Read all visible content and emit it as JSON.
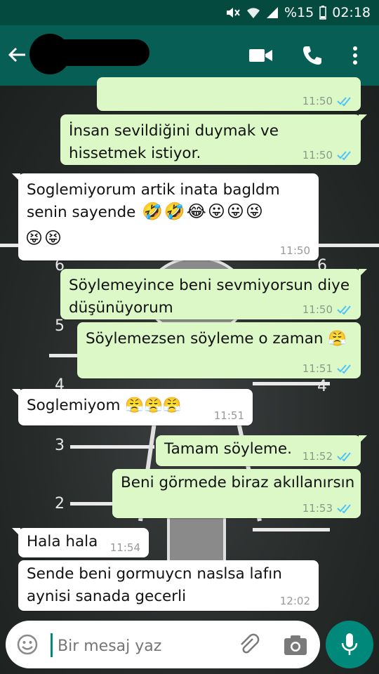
{
  "status_bar": {
    "battery": "%15",
    "time": "02:18"
  },
  "header": {
    "contact_name": ""
  },
  "wallpaper": {
    "ruler_numbers": [
      "6",
      "6",
      "5",
      "4",
      "4",
      "3",
      "2"
    ]
  },
  "messages": [
    {
      "text": "",
      "time": "11:50"
    },
    {
      "text": "İnsan sevildiğini duymak ve\nhissetmek istiyor.",
      "time": "11:50"
    },
    {
      "text": "Soglemiyorum artik inata bagldm\nsenin sayende",
      "emoji": [
        "🤣",
        "🤣",
        "😂",
        "😛",
        "😛",
        "😜",
        "😝",
        "😝"
      ],
      "time": "11:50"
    },
    {
      "text": "Söylemeyince beni sevmiyorsun diye\ndüşünüyorum",
      "time": "11:50"
    },
    {
      "text": "Söylemezsen söyleme o zaman 😤",
      "time": "11:51"
    },
    {
      "text": "Soglemiyom 😤😤😤",
      "time": "11:51"
    },
    {
      "text": "Tamam söyleme.",
      "time": "11:52"
    },
    {
      "text": "Beni görmede biraz akıllanırsın",
      "time": "11:53"
    },
    {
      "text": "Hala hala",
      "time": "11:54"
    },
    {
      "text": "Sende beni gormuycn naslsa lafın\naynisi sanada gecerli",
      "time": "12:02"
    }
  ],
  "composer": {
    "placeholder": "Bir mesaj yaz"
  },
  "colors": {
    "header": "#075e54",
    "statusbar": "#054a3e",
    "outgoing": "#dcf8c6",
    "incoming": "#ffffff",
    "tick": "#4fc3f7",
    "mic": "#00897b"
  },
  "icons": [
    "back-arrow-icon",
    "video-call-icon",
    "voice-call-icon",
    "more-menu-icon",
    "emoji-icon",
    "attach-icon",
    "camera-icon",
    "mic-icon",
    "double-check-icon"
  ]
}
